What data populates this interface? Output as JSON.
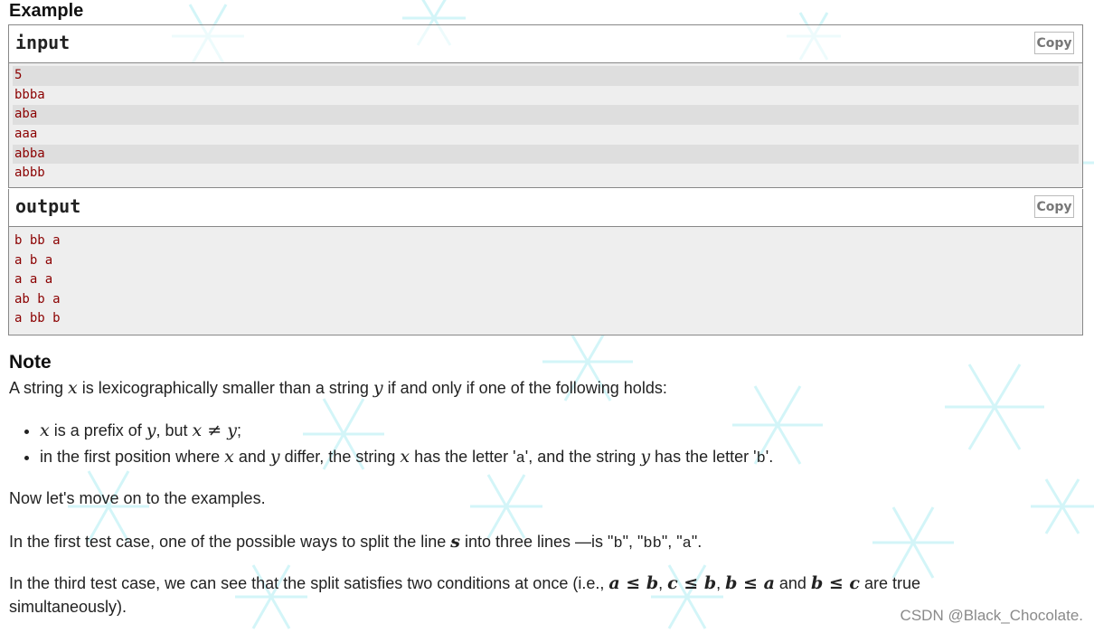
{
  "example": {
    "title": "Example",
    "input": {
      "label": "input",
      "copy_label": "Copy",
      "lines": [
        "5",
        "bbba",
        "aba",
        "aaa",
        "abba",
        "abbb"
      ]
    },
    "output": {
      "label": "output",
      "copy_label": "Copy",
      "lines": [
        "b bb a",
        "a b a",
        "a a a",
        "ab b a",
        "a bb b"
      ]
    }
  },
  "note": {
    "title": "Note",
    "intro": {
      "t1": "A string ",
      "x": "x",
      "t2": " is lexicographically smaller than a string ",
      "y": "y",
      "t3": " if and only if one of the following holds:"
    },
    "bullet1": {
      "x1": "x",
      "t1": " is a prefix of ",
      "y1": "y",
      "t2": ", but ",
      "expr": "x ≠ y",
      "t3": ";"
    },
    "bullet2": {
      "t1": "in the first position where ",
      "x1": "x",
      "t2": " and ",
      "y1": "y",
      "t3": " differ, the string ",
      "x2": "x",
      "t4": " has the letter '",
      "a": "a",
      "t5": "', and the string ",
      "y2": "y",
      "t6": " has the letter '",
      "b": "b",
      "t7": "'."
    },
    "para1": "Now let's move on to the examples.",
    "para2": {
      "t1": "In the first test case, one of the possible ways to split the line ",
      "s": "s",
      "t2": " into three lines —is \"",
      "q1": "b",
      "t3": "\", \"",
      "q2": "bb",
      "t4": "\", \"",
      "q3": "a",
      "t5": "\"."
    },
    "para3": {
      "t1": "In the third test case, we can see that the split satisfies two conditions at once (i.e., ",
      "e1": "a ≤ b",
      "c1": ", ",
      "e2": "c ≤ b",
      "c2": ", ",
      "e3": "b ≤ a",
      "t2": " and ",
      "e4": "b ≤ c",
      "t3": " are true",
      "t4": "simultaneously)."
    }
  },
  "watermark": "CSDN @Black_Chocolate."
}
